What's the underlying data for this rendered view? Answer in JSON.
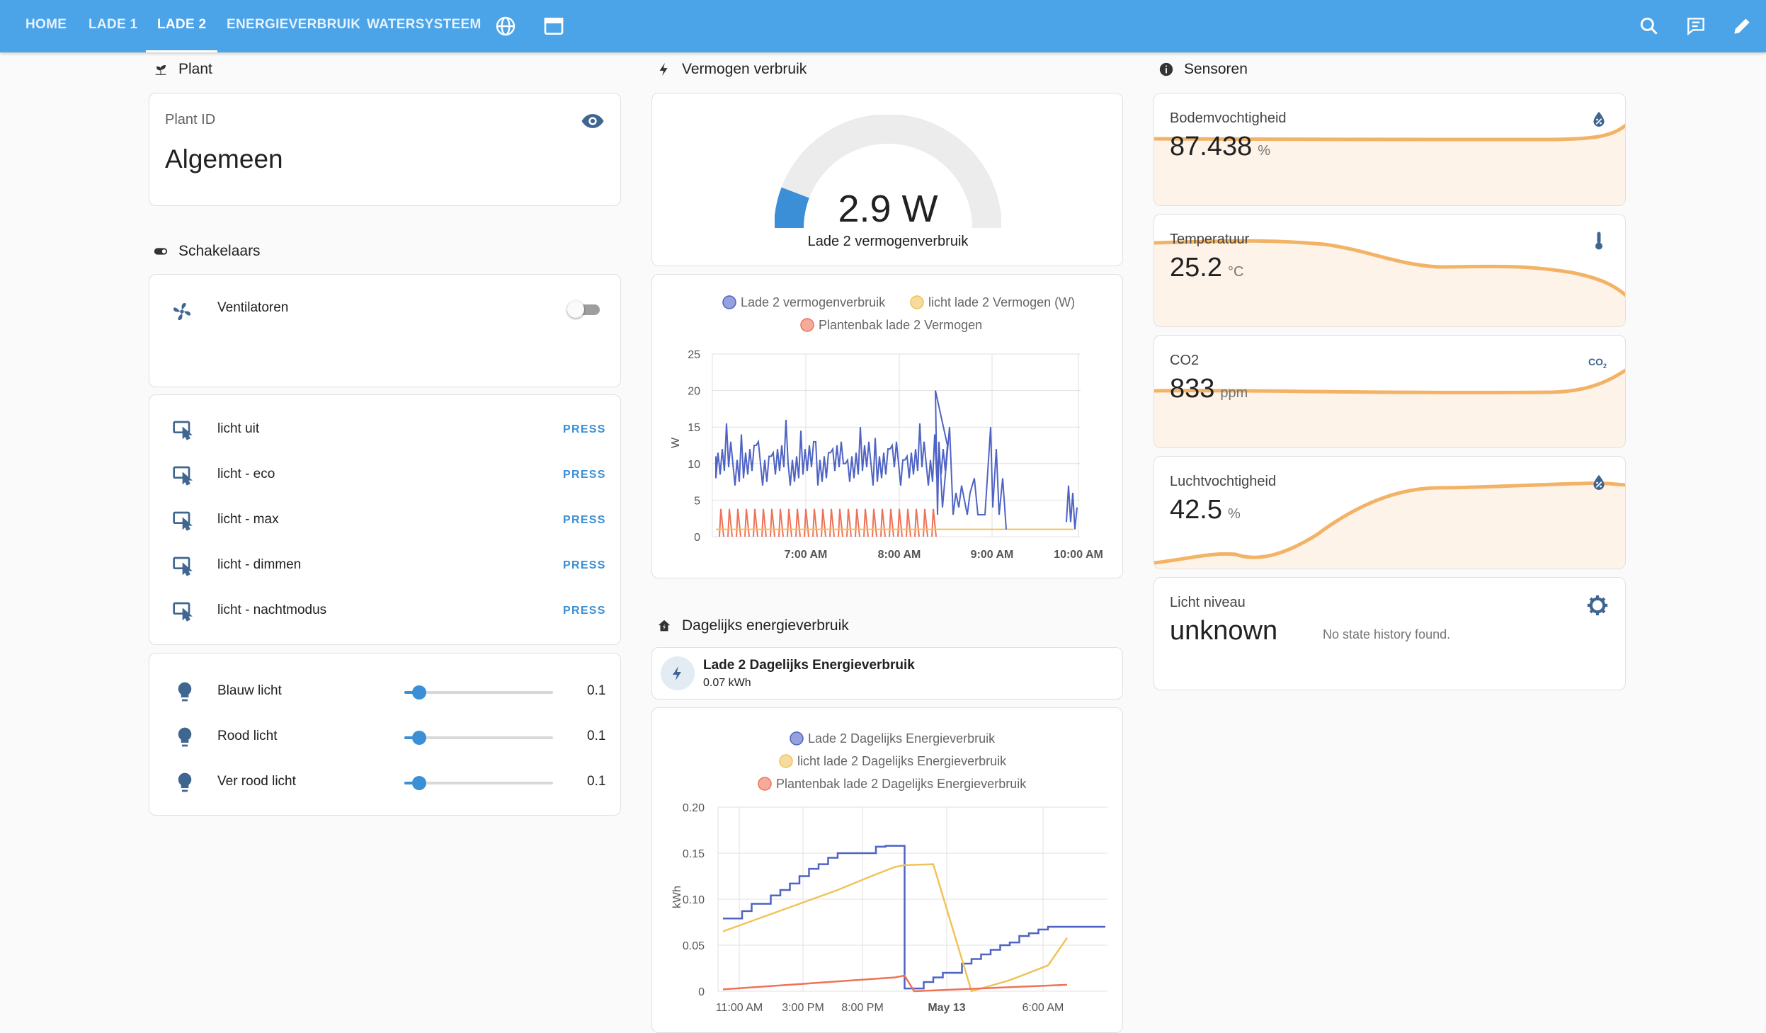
{
  "nav": {
    "tabs": [
      {
        "label": "HOME"
      },
      {
        "label": "LADE 1"
      },
      {
        "label": "LADE 2"
      },
      {
        "label": "ENERGIEVERBRUIK"
      },
      {
        "label": "WATERSYSTEEM"
      }
    ],
    "active_tab": "LADE 2",
    "icons": [
      "globe-icon",
      "window-icon",
      "search-icon",
      "assist-icon",
      "edit-icon"
    ]
  },
  "plant": {
    "section_title": "Plant",
    "card_label": "Plant ID",
    "card_value": "Algemeen"
  },
  "switches": {
    "section_title": "Schakelaars",
    "ventilatoren": {
      "label": "Ventilatoren",
      "state": "off"
    }
  },
  "buttons": {
    "press_label": "PRESS",
    "items": [
      {
        "label": "licht uit"
      },
      {
        "label": "licht - eco"
      },
      {
        "label": "licht - max"
      },
      {
        "label": "licht - dimmen"
      },
      {
        "label": "licht - nachtmodus"
      }
    ]
  },
  "sliders": [
    {
      "label": "Blauw licht",
      "value": "0.1",
      "fraction": 0.1
    },
    {
      "label": "Rood licht",
      "value": "0.1",
      "fraction": 0.1
    },
    {
      "label": "Ver rood licht",
      "value": "0.1",
      "fraction": 0.1
    }
  ],
  "power": {
    "section_title": "Vermogen verbruik",
    "gauge_value": "2.9 W",
    "gauge_label": "Lade 2 vermogenverbruik",
    "gauge_fraction": 0.116
  },
  "energy": {
    "section_title": "Dagelijks energieverbruik",
    "entity_name": "Lade 2 Dagelijks Energieverbruik",
    "entity_value": "0.07 kWh"
  },
  "sensors": {
    "section_title": "Sensoren",
    "items": [
      {
        "name": "Bodemvochtigheid",
        "value": "87.438",
        "unit": "%"
      },
      {
        "name": "Temperatuur",
        "value": "25.2",
        "unit": "°C"
      },
      {
        "name": "CO2",
        "value": "833",
        "unit": "ppm"
      },
      {
        "name": "Luchtvochtigheid",
        "value": "42.5",
        "unit": "%"
      }
    ],
    "light": {
      "name": "Licht niveau",
      "value": "unknown",
      "note": "No state history found."
    }
  },
  "colors": {
    "accent": "#4ba3e8",
    "blue_series": "#4f63c4",
    "yellow_series": "#f0c35a",
    "red_series": "#ef7257",
    "sensor_line": "#f3b366",
    "sensor_fill": "#fdf3e8"
  },
  "chart_data": [
    {
      "type": "line",
      "legend": [
        "Lade 2 vermogenverbruik",
        "licht lade 2 Vermogen (W)",
        "Plantenbak lade 2 Vermogen"
      ],
      "ylabel": "W",
      "ylim": [
        0,
        25
      ],
      "yticks": [
        "25",
        "20",
        "15",
        "10",
        "5",
        "0"
      ],
      "xticks": [
        "7:00 AM",
        "8:00 AM",
        "9:00 AM",
        "10:00 AM"
      ],
      "series": [
        {
          "name": "Lade 2 vermogenverbruik",
          "summary": "oscillates ~6-13 W, spikes to 20 W near 8:20 AM, 15 W near 9:15 AM"
        },
        {
          "name": "licht lade 2 Vermogen (W)",
          "summary": "~1 W baseline"
        },
        {
          "name": "Plantenbak lade 2 Vermogen",
          "summary": "pulses 0-4 W"
        }
      ]
    },
    {
      "type": "line",
      "legend": [
        "Lade 2 Dagelijks Energieverbruik",
        "licht lade 2 Dagelijks Energieverbruik",
        "Plantenbak lade 2 Dagelijks Energieverbruik"
      ],
      "ylabel": "kWh",
      "ylim": [
        0,
        0.2
      ],
      "yticks": [
        "0.20",
        "0.15",
        "0.10",
        "0.05",
        "0"
      ],
      "xticks": [
        "11:00 AM",
        "3:00 PM",
        "8:00 PM",
        "May 13",
        "6:00 AM"
      ],
      "series": [
        {
          "name": "Lade 2 Dagelijks Energieverbruik",
          "x": [
            0,
            0.5,
            1,
            1.5,
            2,
            2.5,
            3,
            3.5,
            4,
            4.5,
            5,
            5.5,
            6,
            6.5,
            7,
            7.5,
            8,
            8.5,
            9,
            9.5,
            10,
            10.5,
            11,
            11.5,
            12,
            12.5,
            13,
            13.5,
            14,
            14.5,
            15,
            15.5,
            16,
            16.5,
            17,
            17.5,
            18,
            18.5,
            19,
            19.5,
            20
          ],
          "values": [
            0.079,
            0.079,
            0.087,
            0.095,
            0.095,
            0.104,
            0.11,
            0.117,
            0.125,
            0.133,
            0.138,
            0.145,
            0.15,
            0.15,
            0.15,
            0.15,
            0.157,
            0.158,
            0.158,
            0.003,
            0.003,
            0.01,
            0.015,
            0.02,
            0.02,
            0.03,
            0.035,
            0.04,
            0.045,
            0.05,
            0.053,
            0.06,
            0.063,
            0.067,
            0.07,
            0.07,
            0.07,
            0.07,
            0.07,
            0.07,
            0.07
          ]
        },
        {
          "name": "licht lade 2 Dagelijks Energieverbruik",
          "x": [
            0,
            2,
            4,
            6,
            8,
            9,
            9.5,
            11,
            13,
            15,
            17,
            18
          ],
          "values": [
            0.065,
            0.08,
            0.095,
            0.11,
            0.127,
            0.135,
            0.137,
            0.138,
            0.0,
            0.012,
            0.028,
            0.058
          ]
        },
        {
          "name": "Plantenbak lade 2 Dagelijks Energieverbruik",
          "x": [
            0,
            9,
            9.5,
            10,
            18
          ],
          "values": [
            0.002,
            0.015,
            0.017,
            0.0,
            0.007
          ]
        }
      ]
    }
  ]
}
